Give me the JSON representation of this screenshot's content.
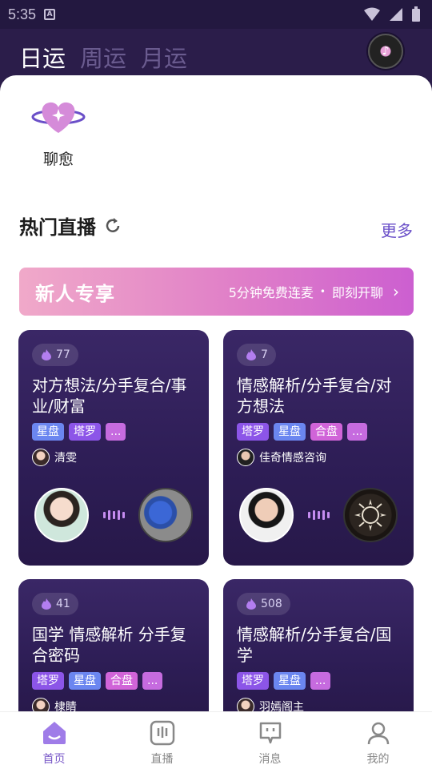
{
  "status_bar": {
    "time": "5:35"
  },
  "header": {
    "tabs": [
      {
        "label": "日运",
        "active": true
      },
      {
        "label": "周运",
        "active": false
      },
      {
        "label": "月运",
        "active": false
      }
    ],
    "music_icon": "music-disc-icon"
  },
  "healing": {
    "label": "聊愈",
    "icon": "heart-planet-icon"
  },
  "hot_live": {
    "title": "热门直播",
    "more": "更多"
  },
  "promo": {
    "title": "新人专享",
    "subtitle": "5分钟免费连麦",
    "dot": "•",
    "cta": "即刻开聊",
    "chevron": "›"
  },
  "cards": [
    {
      "views": "77",
      "title": "对方想法/分手复合/事业/财富",
      "tags": [
        {
          "label": "星盘",
          "kind": "star"
        },
        {
          "label": "塔罗",
          "kind": "tarot"
        },
        {
          "label": "...",
          "kind": "more"
        }
      ],
      "host": "清雯"
    },
    {
      "views": "7",
      "title": "情感解析/分手复合/对方想法",
      "tags": [
        {
          "label": "塔罗",
          "kind": "tarot"
        },
        {
          "label": "星盘",
          "kind": "star"
        },
        {
          "label": "合盘",
          "kind": "combo"
        },
        {
          "label": "...",
          "kind": "more"
        }
      ],
      "host": "佳奇情感咨询"
    },
    {
      "views": "41",
      "title": "国学 情感解析 分手复合密码",
      "tags": [
        {
          "label": "塔罗",
          "kind": "tarot"
        },
        {
          "label": "星盘",
          "kind": "star"
        },
        {
          "label": "合盘",
          "kind": "combo"
        },
        {
          "label": "...",
          "kind": "more"
        }
      ],
      "host": "棣睛"
    },
    {
      "views": "508",
      "title": "情感解析/分手复合/国学",
      "tags": [
        {
          "label": "塔罗",
          "kind": "tarot"
        },
        {
          "label": "星盘",
          "kind": "star"
        },
        {
          "label": "...",
          "kind": "more"
        }
      ],
      "host": "羽嫣阁主"
    }
  ],
  "bottom_nav": [
    {
      "label": "首页",
      "icon": "home-icon",
      "active": true
    },
    {
      "label": "直播",
      "icon": "live-icon",
      "active": false
    },
    {
      "label": "消息",
      "icon": "message-icon",
      "active": false
    },
    {
      "label": "我的",
      "icon": "profile-icon",
      "active": false
    }
  ],
  "colors": {
    "accent": "#7a5ac8",
    "header_bg": "#2b1d4a",
    "card_bg": "#2d1d55"
  }
}
